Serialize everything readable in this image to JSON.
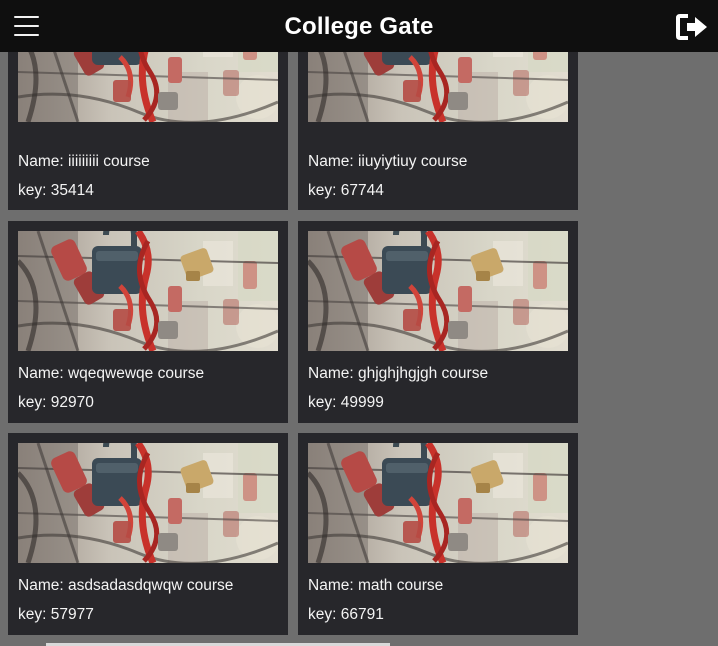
{
  "header": {
    "title": "College Gate",
    "menu_icon": "hamburger-menu-icon",
    "logout_icon": "sign-out-icon"
  },
  "courses": [
    {
      "name": "Name: iiiiiiiii course",
      "key": "key: 35414"
    },
    {
      "name": "Name: iiuyiytiuy course",
      "key": "key: 67744"
    },
    {
      "name": "Name: wqeqwewqe course",
      "key": "key: 92970"
    },
    {
      "name": "Name: ghjghjhgjgh course",
      "key": "key: 49999"
    },
    {
      "name": "Name: asdsadasdqwqw course",
      "key": "key: 57977"
    },
    {
      "name": "Name: math course",
      "key": "key: 66791"
    }
  ],
  "colors": {
    "topbar": "#0f0f0f",
    "background": "#6e6e6e",
    "card": "#27272b",
    "text": "#f4f4f4"
  }
}
